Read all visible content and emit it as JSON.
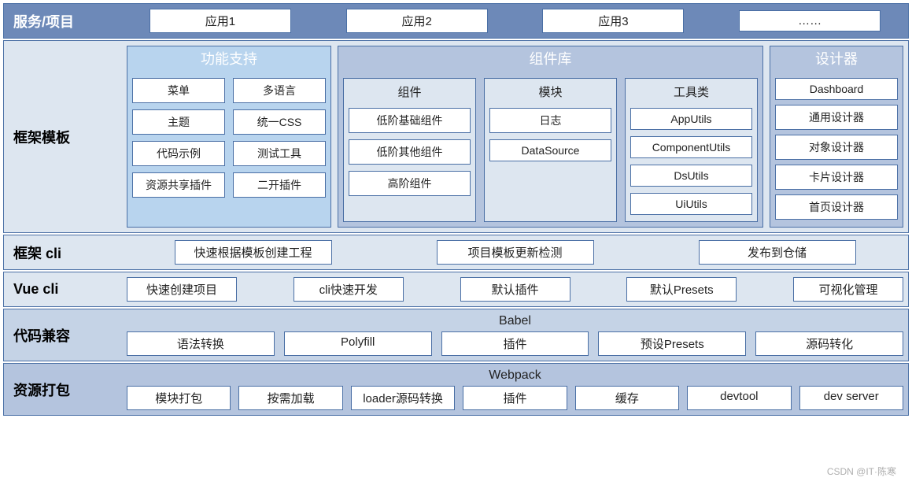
{
  "row1": {
    "label": "服务/项目",
    "items": [
      "应用1",
      "应用2",
      "应用3",
      "……"
    ]
  },
  "row2": {
    "label": "框架模板",
    "feature": {
      "title": "功能支持",
      "items": [
        "菜单",
        "多语言",
        "主题",
        "统一CSS",
        "代码示例",
        "测试工具",
        "资源共享插件",
        "二开插件"
      ]
    },
    "complib": {
      "title": "组件库",
      "cols": [
        {
          "title": "组件",
          "items": [
            "低阶基础组件",
            "低阶其他组件",
            "高阶组件"
          ]
        },
        {
          "title": "模块",
          "items": [
            "日志",
            "DataSource"
          ]
        },
        {
          "title": "工具类",
          "items": [
            "AppUtils",
            "ComponentUtils",
            "DsUtils",
            "UiUtils"
          ]
        }
      ]
    },
    "designer": {
      "title": "设计器",
      "items": [
        "Dashboard",
        "通用设计器",
        "对象设计器",
        "卡片设计器",
        "首页设计器"
      ]
    }
  },
  "row3": {
    "label": "框架 cli",
    "items": [
      "快速根据模板创建工程",
      "项目模板更新检测",
      "发布到仓储"
    ]
  },
  "row4": {
    "label": "Vue cli",
    "items": [
      "快速创建项目",
      "cli快速开发",
      "默认插件",
      "默认Presets",
      "可视化管理"
    ]
  },
  "row5": {
    "label": "代码兼容",
    "title": "Babel",
    "items": [
      "语法转换",
      "Polyfill",
      "插件",
      "预设Presets",
      "源码转化"
    ]
  },
  "row6": {
    "label": "资源打包",
    "title": "Webpack",
    "items": [
      "模块打包",
      "按需加载",
      "loader源码转换",
      "插件",
      "缓存",
      "devtool",
      "dev server"
    ]
  },
  "watermark": "CSDN @IT·陈寒"
}
